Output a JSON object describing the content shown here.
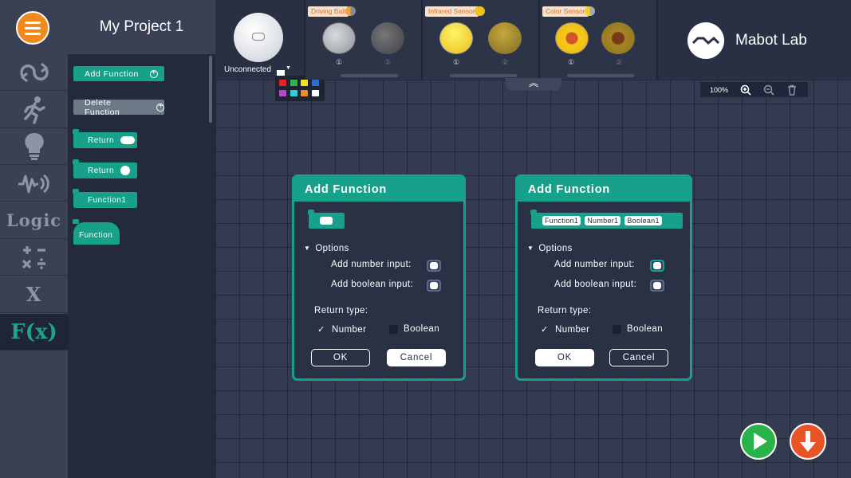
{
  "project": {
    "title": "My Project 1"
  },
  "rail": {
    "items": [
      {
        "name": "loop",
        "icon": "loop-icon"
      },
      {
        "name": "motion",
        "icon": "running-person-icon"
      },
      {
        "name": "light",
        "icon": "bulb-icon"
      },
      {
        "name": "sound",
        "icon": "sound-wave-icon"
      },
      {
        "name": "logic",
        "label": "Logic"
      },
      {
        "name": "math",
        "icon": "math-operators-icon"
      },
      {
        "name": "variables",
        "label": "X"
      },
      {
        "name": "functions",
        "label": "F(x)",
        "active": true
      }
    ]
  },
  "palette": {
    "add_function": "Add Function",
    "delete_function": "Delete Function",
    "blocks": [
      {
        "label": "Return"
      },
      {
        "label": "Return"
      },
      {
        "label": "Function1"
      },
      {
        "label": "Function"
      }
    ]
  },
  "devices": {
    "main": {
      "status": "Unconnected"
    },
    "swatch_colors": [
      "#e8242a",
      "#36b34a",
      "#f5e31b",
      "#2a6fd8",
      "#b54ac8",
      "#2fd0d8",
      "#f18b1e",
      "#ffffff"
    ],
    "modules": [
      {
        "label": "Driving Ball",
        "units": [
          "①",
          "②"
        ]
      },
      {
        "label": "Infrared Sensor",
        "units": [
          "①",
          "②"
        ]
      },
      {
        "label": "Color Sensor",
        "units": [
          "①",
          "②"
        ]
      }
    ],
    "brand": "Mabot Lab",
    "collapse": "︽"
  },
  "zoom": {
    "level": "100%"
  },
  "dialogs": [
    {
      "title": "Add Function",
      "preview_chips": [],
      "options_label": "Options",
      "number_input_label": "Add number input:",
      "boolean_input_label": "Add boolean input:",
      "number_input_on": false,
      "boolean_input_on": false,
      "return_type_label": "Return type:",
      "return_number": "Number",
      "return_boolean": "Boolean",
      "check": "✓",
      "ok": "OK",
      "cancel": "Cancel"
    },
    {
      "title": "Add Function",
      "preview_chips": [
        "Function1",
        "Number1",
        "Boolean1"
      ],
      "options_label": "Options",
      "number_input_label": "Add number input:",
      "boolean_input_label": "Add boolean input:",
      "number_input_on": true,
      "boolean_input_on": true,
      "return_type_label": "Return type:",
      "return_number": "Number",
      "return_boolean": "Boolean",
      "check": "✓",
      "ok": "OK",
      "cancel": "Cancel"
    }
  ],
  "colors": {
    "accent": "#17a08a",
    "menu": "#f08a1c",
    "run": "#29b24a",
    "download": "#e95427"
  }
}
